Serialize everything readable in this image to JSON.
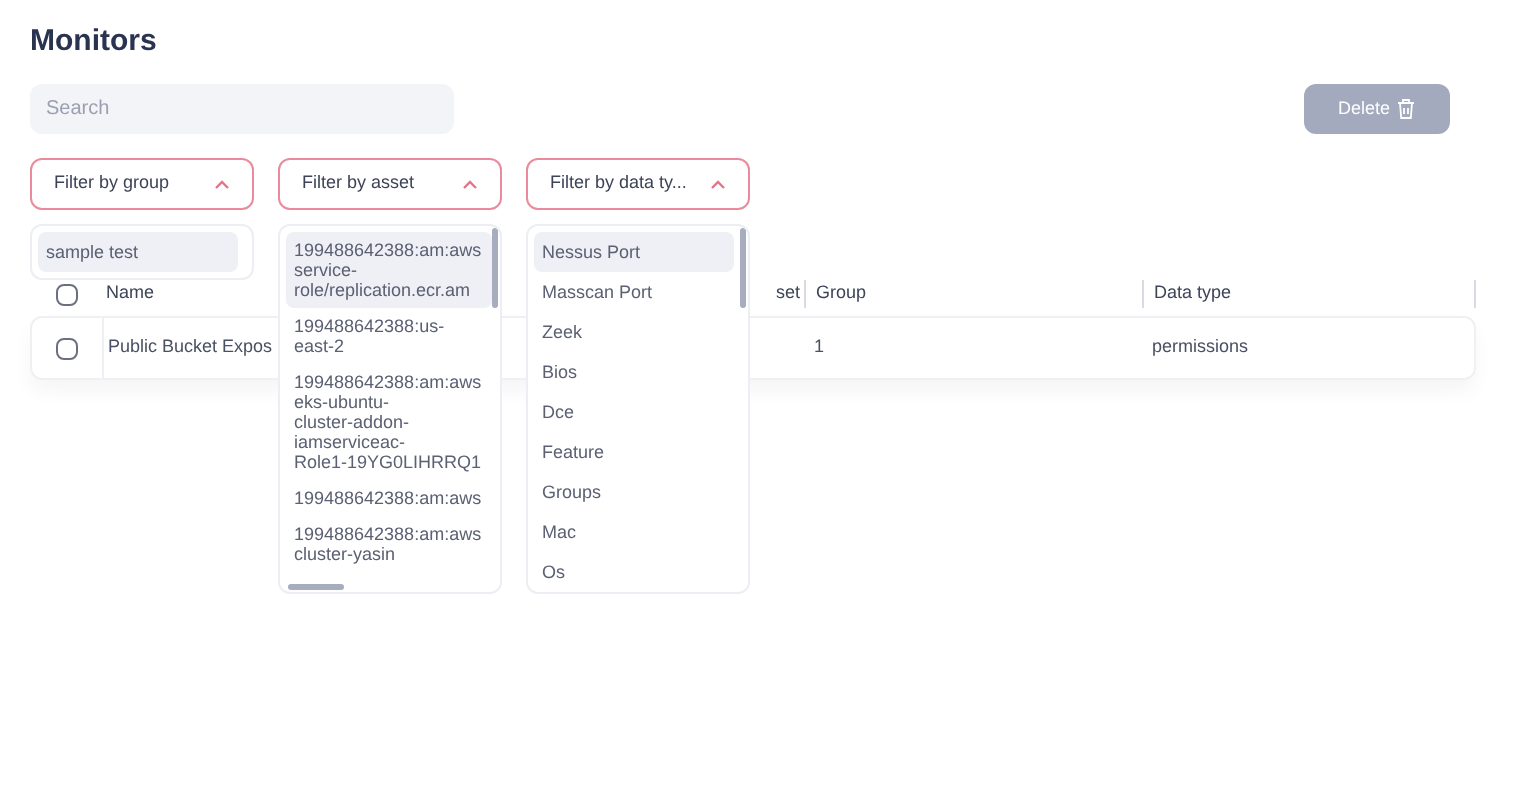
{
  "title": "Monitors",
  "search": {
    "placeholder": "Search"
  },
  "delete_button": {
    "label": "Delete",
    "disabled": true
  },
  "filters": [
    {
      "label": "Filter by group",
      "expanded": true,
      "options": [
        {
          "lines": [
            "sample test"
          ],
          "highlighted": true
        }
      ]
    },
    {
      "label": "Filter by asset",
      "expanded": true,
      "options": [
        {
          "lines": [
            "199488642388:am:aws",
            "service-",
            "role/replication.ecr.am"
          ],
          "highlighted": true
        },
        {
          "lines": [
            "199488642388:us-",
            "east-2"
          ],
          "highlighted": false
        },
        {
          "lines": [
            "199488642388:am:aws",
            "eks-ubuntu-",
            "cluster-addon-",
            "iamserviceac-",
            "Role1-19YG0LIHRRQ1"
          ],
          "highlighted": false
        },
        {
          "lines": [
            "199488642388:am:aws"
          ],
          "highlighted": false
        },
        {
          "lines": [
            "199488642388:am:aws",
            "cluster-yasin"
          ],
          "highlighted": false
        }
      ]
    },
    {
      "label": "Filter by data ty...",
      "expanded": true,
      "options": [
        {
          "lines": [
            "Nessus Port"
          ],
          "highlighted": true
        },
        {
          "lines": [
            "Masscan Port"
          ],
          "highlighted": false
        },
        {
          "lines": [
            "Zeek"
          ],
          "highlighted": false
        },
        {
          "lines": [
            "Bios"
          ],
          "highlighted": false
        },
        {
          "lines": [
            "Dce"
          ],
          "highlighted": false
        },
        {
          "lines": [
            "Feature"
          ],
          "highlighted": false
        },
        {
          "lines": [
            "Groups"
          ],
          "highlighted": false
        },
        {
          "lines": [
            "Mac"
          ],
          "highlighted": false
        },
        {
          "lines": [
            "Os"
          ],
          "highlighted": false
        }
      ]
    }
  ],
  "table": {
    "columns": [
      "Name",
      "set",
      "Group",
      "Data type"
    ],
    "select_all_checked": false,
    "rows": [
      {
        "checked": false,
        "cells": [
          "Public Bucket Expos",
          "",
          "1",
          "permissions"
        ]
      }
    ]
  }
}
